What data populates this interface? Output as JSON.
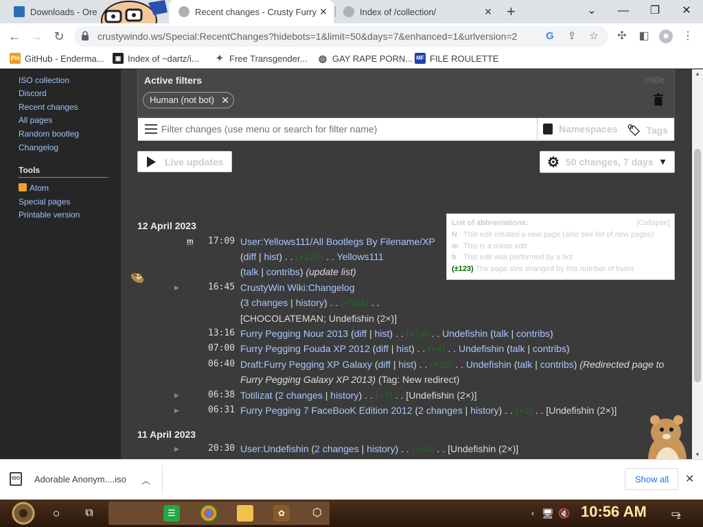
{
  "browser": {
    "tabs": [
      {
        "title": "Downloads - Ore",
        "favicon_color": "#2a6fb5"
      },
      {
        "title": "Recent changes - Crusty Furry",
        "favicon_color": "#9a9a9a"
      },
      {
        "title": "Index of /collection/",
        "favicon_color": "#9a9a9a"
      }
    ],
    "new_tab": "+",
    "url": "crustywindo.ws/Special:RecentChanges?hidebots=1&limit=50&days=7&enhanced=1&urlversion=2",
    "bookmarks": [
      {
        "label": "GitHub - Enderma...",
        "icon": "PH",
        "color": "#f29b1c"
      },
      {
        "label": "Index of ~dartz/i...",
        "icon": "▣",
        "color": "#222222"
      },
      {
        "label": "Free Transgender...",
        "icon": "✦",
        "color": "#555555"
      },
      {
        "label": "GAY RAPE PORN...",
        "icon": "◍",
        "color": "#555555"
      },
      {
        "label": "FILE ROULETTE",
        "icon": "MF",
        "color": "#1d44a8"
      }
    ]
  },
  "sidebar": {
    "links_top": [
      "ISO collection",
      "Discord",
      "Recent changes",
      "All pages",
      "Random bootleg",
      "Changelog"
    ],
    "tools_heading": "Tools",
    "tools": [
      "Atom",
      "Special pages",
      "Printable version"
    ]
  },
  "filters": {
    "title": "Active filters",
    "hide": "Hide",
    "chip": "Human (not bot)",
    "search_placeholder": "Filter changes (use menu or search for filter name)",
    "namespaces": "Namespaces",
    "tags": "Tags",
    "live_updates": "Live updates",
    "options": "50 changes, 7 days"
  },
  "legend": {
    "title": "List of abbreviations:",
    "collapse": "[Collapse]",
    "rows": [
      {
        "key": "N",
        "text": "This edit created a new page (also see list of new pages)"
      },
      {
        "key": "m",
        "text": "This is a minor edit"
      },
      {
        "key": "b",
        "text": "This edit was performed by a bot"
      },
      {
        "key": "(±123)",
        "text": "The page size changed by this number of bytes"
      }
    ]
  },
  "changes": {
    "day1": "12 April 2023",
    "day2": "11 April 2023",
    "e1": {
      "flag": "m",
      "time": "17:09",
      "title": "User:Yellows111/All Bootlegs By Filename/XP",
      "diff": "diff",
      "hist": "hist",
      "size": "(+120)",
      "user": "Yellows111",
      "talk": "talk",
      "contribs": "contribs",
      "summary": "(update list)"
    },
    "e2": {
      "time": "16:45",
      "title": "CrustyWin Wiki:Changelog",
      "changes": "3 changes",
      "history": "history",
      "size": "(+324)",
      "users": "[CHOCOLATEMAN; Undefishin (2×)]"
    },
    "e3": {
      "time": "13:16",
      "title": "Furry Pegging Nour 2013",
      "size": "(+24)",
      "user": "Undefishin"
    },
    "e4": {
      "time": "07:00",
      "title": "Furry Pegging Fouda XP 2012",
      "size": "(+4)",
      "user": "Undefishin"
    },
    "e5": {
      "time": "06:40",
      "title": "Draft:Furry Pegging XP Galaxy",
      "size": "(+38)",
      "user": "Undefishin",
      "summary": "(Redirected page to",
      "summary2": "Furry Pegging Galaxy XP 2013)",
      "tag": "(Tag: New redirect)"
    },
    "e6": {
      "time": "06:38",
      "title": "Totilizat",
      "changes": "2 changes",
      "size": "(+7)",
      "users": "[Undefishin (2×)]"
    },
    "e7": {
      "time": "06:31",
      "title": "Furry Pegging 7 FaceBooK Edition 2012",
      "changes": "2 changes",
      "size": "(+2)",
      "users": "[Undefishin (2×)]"
    },
    "e8": {
      "time": "20:30",
      "title": "User:Undefishin",
      "changes": "2 changes",
      "size": "(+44)",
      "users": "[Undefishin (2×)]"
    }
  },
  "downloads": {
    "file": "Adorable Anonym....iso",
    "show_all": "Show all"
  },
  "taskbar": {
    "clock": "10:56 AM",
    "notifications": "2"
  }
}
